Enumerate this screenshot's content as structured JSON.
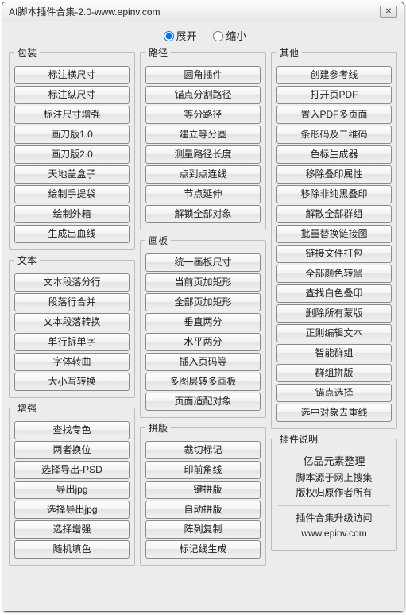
{
  "title": "AI脚本插件合集-2.0-www.epinv.com",
  "radios": {
    "expand": "展开",
    "collapse": "缩小"
  },
  "col1": {
    "group1": {
      "title": "包装",
      "items": [
        "标注横尺寸",
        "标注纵尺寸",
        "标注尺寸增强",
        "画刀版1.0",
        "画刀版2.0",
        "天地盖盒子",
        "绘制手提袋",
        "绘制外箱",
        "生成出血线"
      ]
    },
    "group2": {
      "title": "文本",
      "items": [
        "文本段落分行",
        "段落行合并",
        "文本段落转换",
        "单行拆单字",
        "字体转曲",
        "大小写转换"
      ]
    },
    "group3": {
      "title": "增强",
      "items": [
        "查找专色",
        "两者换位",
        "选择导出-PSD",
        "导出jpg",
        "选择导出jpg",
        "选择增强",
        "随机填色"
      ]
    }
  },
  "col2": {
    "group1": {
      "title": "路径",
      "items": [
        "圆角插件",
        "锚点分割路径",
        "等分路径",
        "建立等分圆",
        "测量路径长度",
        "点到点连线",
        "节点延伸",
        "解锁全部对象"
      ]
    },
    "group2": {
      "title": "画板",
      "items": [
        "统一画板尺寸",
        "当前页加矩形",
        "全部页加矩形",
        "垂直两分",
        "水平两分",
        "插入页码等",
        "多图层转多画板",
        "页面适配对象"
      ]
    },
    "group3": {
      "title": "拼版",
      "items": [
        "裁切标记",
        "印前角线",
        "一键拼版",
        "自动拼版",
        "阵列复制",
        "标记线生成"
      ]
    }
  },
  "col3": {
    "group1": {
      "title": "其他",
      "items": [
        "创建参考线",
        "打开页PDF",
        "置入PDF多页面",
        "条形码及二维码",
        "色标生成器",
        "移除叠印属性",
        "移除非纯黑叠印",
        "解散全部群组",
        "批量替换链接图",
        "链接文件打包",
        "全部颜色转黑",
        "查找白色叠印",
        "删除所有蒙版",
        "正则编辑文本",
        "智能群组",
        "群组拼版",
        "锚点选择",
        "选中对象去重线"
      ]
    },
    "group2": {
      "title": "插件说明",
      "desc1": "亿品元素整理",
      "desc2": "脚本源于网上搜集",
      "desc3": "版权归原作者所有",
      "desc4": "插件合集升级访问",
      "desc5": "www.epinv.com"
    }
  }
}
